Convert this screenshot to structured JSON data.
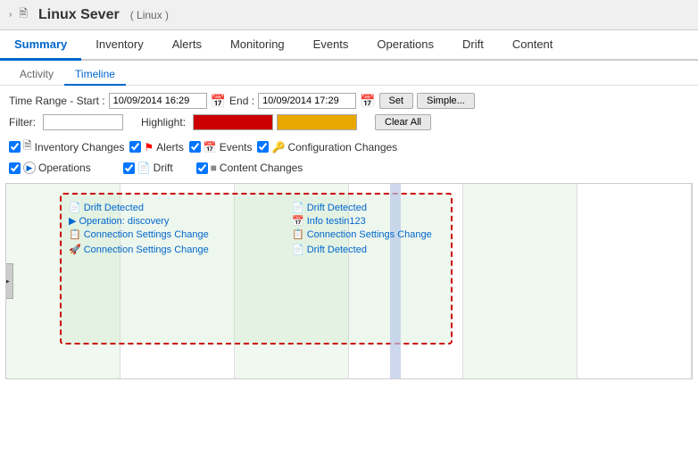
{
  "header": {
    "breadcrumb_arrow": "›",
    "server_icon": "🖥",
    "server_name": "Linux Sever",
    "server_type": "( Linux )"
  },
  "main_tabs": [
    {
      "label": "Summary",
      "active": true
    },
    {
      "label": "Inventory",
      "active": false
    },
    {
      "label": "Alerts",
      "active": false
    },
    {
      "label": "Monitoring",
      "active": false
    },
    {
      "label": "Events",
      "active": false
    },
    {
      "label": "Operations",
      "active": false
    },
    {
      "label": "Drift",
      "active": false
    },
    {
      "label": "Content",
      "active": false
    }
  ],
  "sub_tabs": [
    {
      "label": "Activity",
      "active": false
    },
    {
      "label": "Timeline",
      "active": true
    }
  ],
  "controls": {
    "time_range_label": "Time Range - Start :",
    "start_time": "10/09/2014 16:29",
    "end_label": "End :",
    "end_time": "10/09/2014 17:29",
    "set_btn": "Set",
    "simple_btn": "Simple...",
    "filter_label": "Filter:",
    "highlight_label": "Highlight:",
    "clear_all_btn": "Clear All"
  },
  "checkboxes": [
    {
      "id": "inv",
      "label": "Inventory Changes",
      "checked": true,
      "icon": "📋"
    },
    {
      "id": "alerts",
      "label": "Alerts",
      "checked": true,
      "icon": "🚩"
    },
    {
      "id": "events",
      "label": "Events",
      "checked": true,
      "icon": "📅"
    },
    {
      "id": "config",
      "label": "Configuration Changes",
      "checked": true,
      "icon": "🔑"
    },
    {
      "id": "ops",
      "label": "Operations",
      "checked": true,
      "icon": "▶"
    },
    {
      "id": "drift",
      "label": "Drift",
      "checked": true,
      "icon": "📄"
    },
    {
      "id": "content",
      "label": "Content Changes",
      "checked": true,
      "icon": "🔷"
    }
  ],
  "timeline_events_left": [
    {
      "icon": "📄",
      "label": "Drift Detected"
    },
    {
      "icon": "▶",
      "label": "Operation: discovery"
    },
    {
      "icon": "📋",
      "label": "Connection Settings Change"
    },
    {
      "icon": "🚀",
      "label": "Connection Settings Change"
    }
  ],
  "timeline_events_right": [
    {
      "icon": "📄",
      "label": "Drift Detected"
    },
    {
      "icon": "📅",
      "label": "Info testin123"
    },
    {
      "icon": "📋",
      "label": "Connection Settings Change"
    },
    {
      "icon": "📄",
      "label": "Drift Detected"
    }
  ]
}
